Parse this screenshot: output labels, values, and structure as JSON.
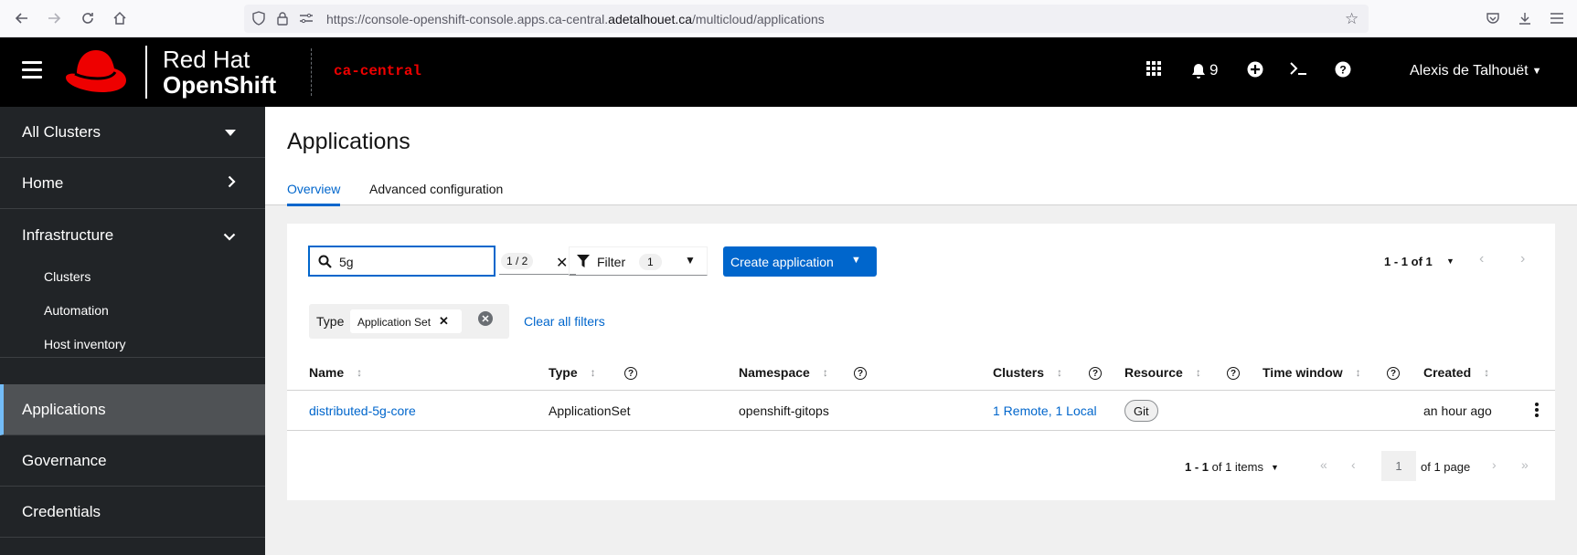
{
  "browser": {
    "url_prefix": "https://console-openshift-console.apps.ca-central.",
    "url_host": "adetalhouet.ca",
    "url_path": "/multicloud/applications"
  },
  "masthead": {
    "brand_line1": "Red Hat",
    "brand_line2": "OpenShift",
    "cluster": "ca-central",
    "notification_count": "9",
    "user": "Alexis de Talhouët"
  },
  "sidebar": {
    "items": [
      {
        "label": "All Clusters"
      },
      {
        "label": "Home"
      },
      {
        "label": "Infrastructure"
      },
      {
        "label": "Applications"
      },
      {
        "label": "Governance"
      },
      {
        "label": "Credentials"
      }
    ],
    "infra_sub": [
      "Clusters",
      "Automation",
      "Host inventory"
    ]
  },
  "page": {
    "title": "Applications",
    "tabs": [
      "Overview",
      "Advanced configuration"
    ]
  },
  "toolbar": {
    "search_value": "5g",
    "match_count": "1 / 2",
    "filter_label": "Filter",
    "filter_count": "1",
    "create_label": "Create application",
    "pager_top": "1 - 1 of 1"
  },
  "filters": {
    "category": "Type",
    "chip": "Application Set",
    "clear_all": "Clear all filters"
  },
  "table": {
    "headers": [
      "Name",
      "Type",
      "Namespace",
      "Clusters",
      "Resource",
      "Time window",
      "Created"
    ],
    "rows": [
      {
        "name": "distributed-5g-core",
        "type": "ApplicationSet",
        "namespace": "openshift-gitops",
        "clusters": "1 Remote, 1 Local",
        "resource": "Git",
        "time_window": "",
        "created": "an hour ago"
      }
    ]
  },
  "pagination": {
    "range_bold": "1 - 1",
    "range_rest": " of 1 items",
    "page": "1",
    "of_page": "of 1 page"
  }
}
